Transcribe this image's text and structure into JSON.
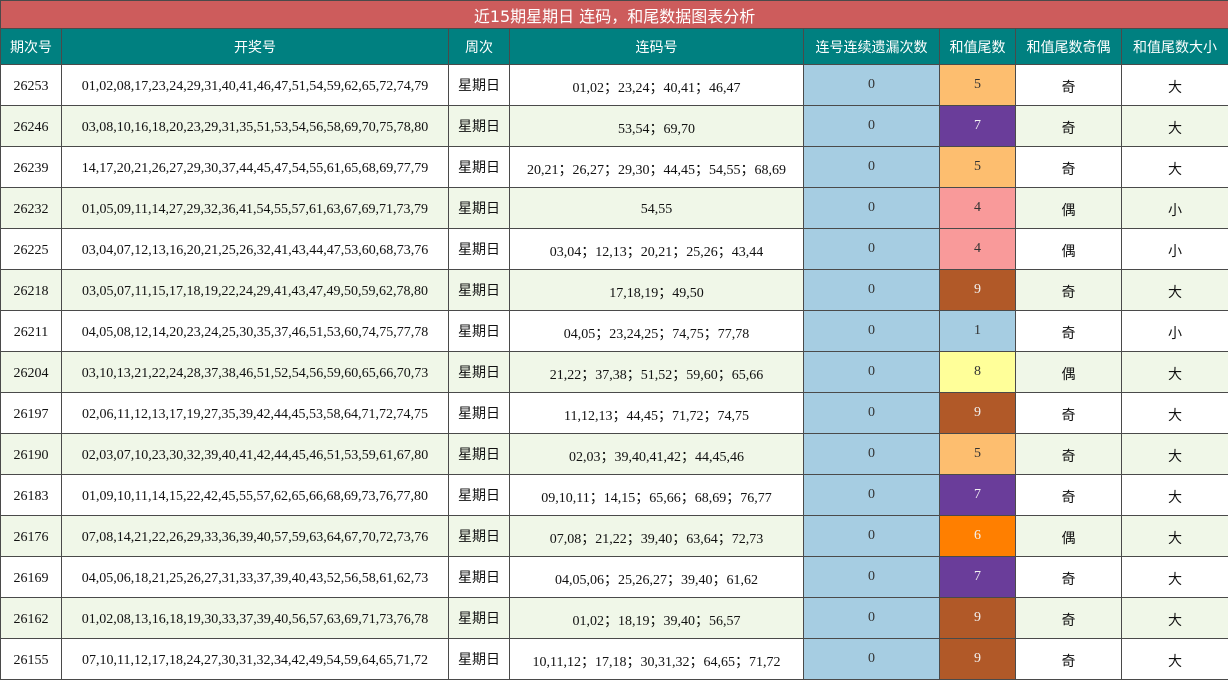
{
  "title": "近15期星期日 连码，和尾数据图表分析",
  "headers": [
    "期次号",
    "开奖号",
    "周次",
    "连码号",
    "连号连续遗漏次数",
    "和值尾数",
    "和值尾数奇偶",
    "和值尾数大小"
  ],
  "tail_colors": {
    "1": "#a6cde2",
    "4": "#f99a9a",
    "5": "#fdbe6f",
    "6": "#ff7f00",
    "7": "#6a3d9a",
    "8": "#ffff99",
    "9": "#b15928"
  },
  "rows": [
    {
      "period": "26253",
      "numbers": "01,02,08,17,23,24,29,31,40,41,46,47,51,54,59,62,65,72,74,79",
      "weekday": "星期日",
      "consecutive": "01,02；23,24；40,41；46,47",
      "miss": "0",
      "tail": "5",
      "parity": "奇",
      "size": "大"
    },
    {
      "period": "26246",
      "numbers": "03,08,10,16,18,20,23,29,31,35,51,53,54,56,58,69,70,75,78,80",
      "weekday": "星期日",
      "consecutive": "53,54；69,70",
      "miss": "0",
      "tail": "7",
      "parity": "奇",
      "size": "大"
    },
    {
      "period": "26239",
      "numbers": "14,17,20,21,26,27,29,30,37,44,45,47,54,55,61,65,68,69,77,79",
      "weekday": "星期日",
      "consecutive": "20,21；26,27；29,30；44,45；54,55；68,69",
      "miss": "0",
      "tail": "5",
      "parity": "奇",
      "size": "大"
    },
    {
      "period": "26232",
      "numbers": "01,05,09,11,14,27,29,32,36,41,54,55,57,61,63,67,69,71,73,79",
      "weekday": "星期日",
      "consecutive": "54,55",
      "miss": "0",
      "tail": "4",
      "parity": "偶",
      "size": "小"
    },
    {
      "period": "26225",
      "numbers": "03,04,07,12,13,16,20,21,25,26,32,41,43,44,47,53,60,68,73,76",
      "weekday": "星期日",
      "consecutive": "03,04；12,13；20,21；25,26；43,44",
      "miss": "0",
      "tail": "4",
      "parity": "偶",
      "size": "小"
    },
    {
      "period": "26218",
      "numbers": "03,05,07,11,15,17,18,19,22,24,29,41,43,47,49,50,59,62,78,80",
      "weekday": "星期日",
      "consecutive": "17,18,19；49,50",
      "miss": "0",
      "tail": "9",
      "parity": "奇",
      "size": "大"
    },
    {
      "period": "26211",
      "numbers": "04,05,08,12,14,20,23,24,25,30,35,37,46,51,53,60,74,75,77,78",
      "weekday": "星期日",
      "consecutive": "04,05；23,24,25；74,75；77,78",
      "miss": "0",
      "tail": "1",
      "parity": "奇",
      "size": "小"
    },
    {
      "period": "26204",
      "numbers": "03,10,13,21,22,24,28,37,38,46,51,52,54,56,59,60,65,66,70,73",
      "weekday": "星期日",
      "consecutive": "21,22；37,38；51,52；59,60；65,66",
      "miss": "0",
      "tail": "8",
      "parity": "偶",
      "size": "大"
    },
    {
      "period": "26197",
      "numbers": "02,06,11,12,13,17,19,27,35,39,42,44,45,53,58,64,71,72,74,75",
      "weekday": "星期日",
      "consecutive": "11,12,13；44,45；71,72；74,75",
      "miss": "0",
      "tail": "9",
      "parity": "奇",
      "size": "大"
    },
    {
      "period": "26190",
      "numbers": "02,03,07,10,23,30,32,39,40,41,42,44,45,46,51,53,59,61,67,80",
      "weekday": "星期日",
      "consecutive": "02,03；39,40,41,42；44,45,46",
      "miss": "0",
      "tail": "5",
      "parity": "奇",
      "size": "大"
    },
    {
      "period": "26183",
      "numbers": "01,09,10,11,14,15,22,42,45,55,57,62,65,66,68,69,73,76,77,80",
      "weekday": "星期日",
      "consecutive": "09,10,11；14,15；65,66；68,69；76,77",
      "miss": "0",
      "tail": "7",
      "parity": "奇",
      "size": "大"
    },
    {
      "period": "26176",
      "numbers": "07,08,14,21,22,26,29,33,36,39,40,57,59,63,64,67,70,72,73,76",
      "weekday": "星期日",
      "consecutive": "07,08；21,22；39,40；63,64；72,73",
      "miss": "0",
      "tail": "6",
      "parity": "偶",
      "size": "大"
    },
    {
      "period": "26169",
      "numbers": "04,05,06,18,21,25,26,27,31,33,37,39,40,43,52,56,58,61,62,73",
      "weekday": "星期日",
      "consecutive": "04,05,06；25,26,27；39,40；61,62",
      "miss": "0",
      "tail": "7",
      "parity": "奇",
      "size": "大"
    },
    {
      "period": "26162",
      "numbers": "01,02,08,13,16,18,19,30,33,37,39,40,56,57,63,69,71,73,76,78",
      "weekday": "星期日",
      "consecutive": "01,02；18,19；39,40；56,57",
      "miss": "0",
      "tail": "9",
      "parity": "奇",
      "size": "大"
    },
    {
      "period": "26155",
      "numbers": "07,10,11,12,17,18,24,27,30,31,32,34,42,49,54,59,64,65,71,72",
      "weekday": "星期日",
      "consecutive": "10,11,12；17,18；30,31,32；64,65；71,72",
      "miss": "0",
      "tail": "9",
      "parity": "奇",
      "size": "大"
    }
  ]
}
